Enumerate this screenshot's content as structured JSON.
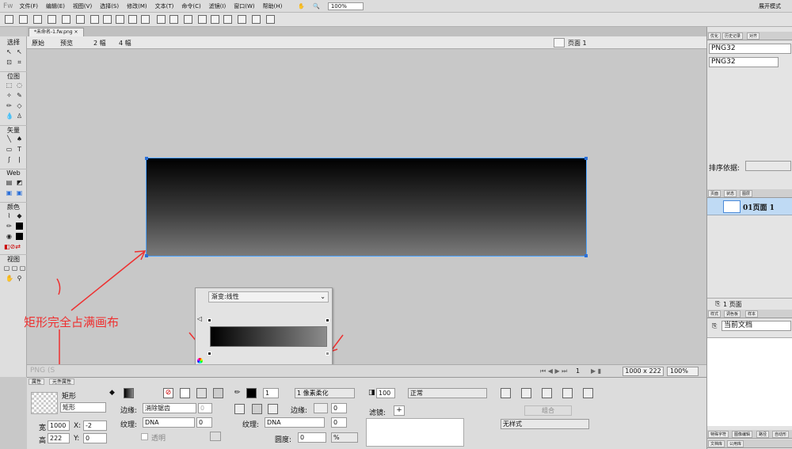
{
  "app_logo": "Fw",
  "menu": {
    "items": [
      "文件(F)",
      "编辑(E)",
      "视图(V)",
      "选择(S)",
      "修改(M)",
      "文本(T)",
      "命令(C)",
      "滤镜(I)",
      "窗口(W)",
      "帮助(H)"
    ],
    "zoom": "100%",
    "layout_mode": "展开模式"
  },
  "doc": {
    "tab": "*未命名-1.fw.png",
    "views": [
      "原始",
      "预览",
      "2 幅",
      "4 幅"
    ],
    "page": "页面 1"
  },
  "tools": {
    "sections": [
      "选择",
      "位图",
      "矢量",
      "Web",
      "颜色",
      "视图"
    ]
  },
  "annotation": "矩形完全占满画布",
  "gradient": {
    "type": "渐变:线性",
    "percent_label": "%",
    "angle": "270"
  },
  "status": {
    "page_num": "1",
    "canvas_size": "1000 x 222",
    "zoom": "100%",
    "watermark": "PNG (S"
  },
  "props": {
    "tabs": [
      "属性",
      "元件属性"
    ],
    "shape_kind": "矩形",
    "shape_name": "矩形",
    "w_label": "宽",
    "w_value": "1000",
    "h_label": "高",
    "h_value": "222",
    "x_label": "X:",
    "x_value": "-2",
    "y_label": "Y:",
    "y_value": "0",
    "edge_label": "边缘:",
    "edge_value": "消除锯齿",
    "edge_num": "0",
    "texture_label": "纹理:",
    "texture_value": "DNA",
    "texture_num": "0",
    "transparent_label": "透明",
    "stroke_size": "1",
    "stroke_type": "1 像素柔化",
    "stroke_edge_label": "边缘:",
    "stroke_edge_num": "0",
    "stroke_texture_label": "纹理:",
    "stroke_texture_value": "DNA",
    "stroke_texture_num": "0",
    "roundness_label": "圆度:",
    "roundness_value": "0",
    "roundness_unit": "%",
    "opacity": "100",
    "blend": "正常",
    "filters_label": "滤镜:",
    "group_label": "组合",
    "style_value": "无样式"
  },
  "right_panel": {
    "top_tabs": [
      "优化",
      "历史记录",
      "对齐"
    ],
    "optimize_field": "PNG32",
    "optimize_select": "PNG32",
    "sort_label": "排序依据:",
    "pages_tabs": [
      "页面",
      "状态",
      "图层"
    ],
    "page_item": "01页面 1",
    "page_count": "1 页面",
    "style_tabs": [
      "样式",
      "调色板",
      "样本"
    ],
    "style_doc": "当前文档",
    "bottom_tabs": [
      "特殊字符",
      "图像编辑",
      "路径",
      "自动形"
    ],
    "bottom_tabs2": [
      "文档库",
      "公用库"
    ]
  }
}
